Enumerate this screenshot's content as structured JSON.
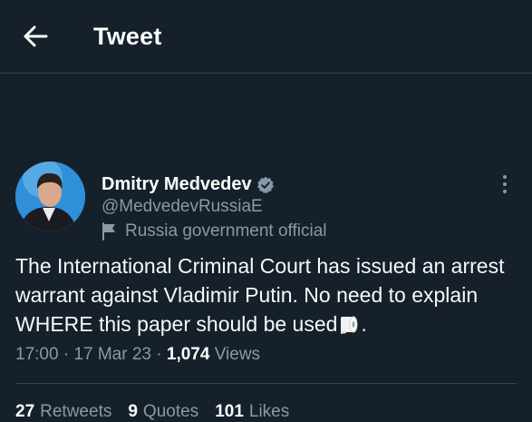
{
  "header": {
    "title": "Tweet",
    "back_icon": "arrow-left-icon"
  },
  "author": {
    "display_name": "Dmitry Medvedev",
    "handle": "@MedvedevRussiaE",
    "verified_icon": "verified-badge-icon",
    "affiliation_label": "Russia government official",
    "affiliation_icon": "flag-icon"
  },
  "tweet": {
    "text_before_emoji": "The International Criminal Court has issued an arrest warrant against Vladimir Putin. No need to explain WHERE this paper should be used",
    "emoji": "toilet-paper-icon",
    "text_after_emoji": ".",
    "time": "17:00",
    "separator": "·",
    "date": "17 Mar 23",
    "views_count": "1,074",
    "views_label": "Views"
  },
  "stats": [
    {
      "count": "27",
      "label": "Retweets"
    },
    {
      "count": "9",
      "label": "Quotes"
    },
    {
      "count": "101",
      "label": "Likes"
    }
  ],
  "colors": {
    "background": "#15202b",
    "secondary_text": "#8b98a5",
    "accent": "#1d9bf0",
    "divider": "#38444d"
  }
}
